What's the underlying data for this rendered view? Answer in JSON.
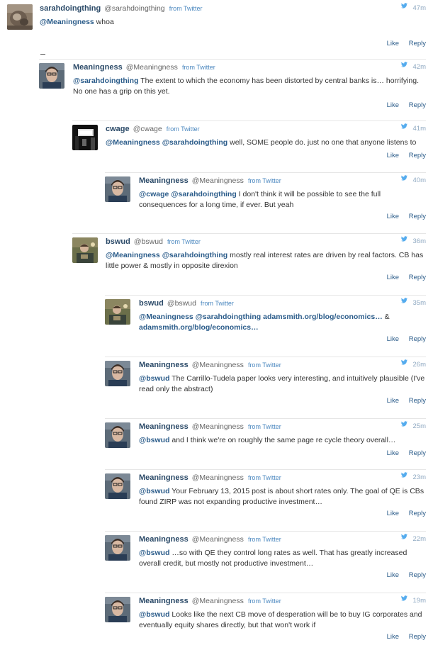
{
  "brand_colors": {
    "name": "#2b4a68",
    "link": "#2b5c8a",
    "source": "#4a87bf",
    "time": "#8fa9c2",
    "divider": "#e6e6e6"
  },
  "tweets": [
    {
      "name": "sarahdoingthing",
      "handle": "@sarahdoingthing",
      "source": "from Twitter",
      "time": "47m",
      "avatar": "sarah-avatar",
      "segments": [
        {
          "t": "@Meaningness",
          "m": true
        },
        {
          "t": " whoa"
        }
      ],
      "like": "Like",
      "reply": "Reply"
    },
    {
      "name": "Meaningness",
      "handle": "@Meaningness",
      "source": "from Twitter",
      "time": "42m",
      "avatar": "meaningness-avatar",
      "segments": [
        {
          "t": "@sarahdoingthing",
          "m": true
        },
        {
          "t": " The extent to which the economy has been distorted by central banks is… horrifying. No one has a grip on this yet."
        }
      ],
      "like": "Like",
      "reply": "Reply"
    },
    {
      "name": "cwage",
      "handle": "@cwage",
      "source": "from Twitter",
      "time": "41m",
      "avatar": "cwage-avatar",
      "segments": [
        {
          "t": "@Meaningness",
          "m": true
        },
        {
          "t": " "
        },
        {
          "t": "@sarahdoingthing",
          "m": true
        },
        {
          "t": " well, SOME people do. just no one that anyone listens to"
        }
      ],
      "like": "Like",
      "reply": "Reply"
    },
    {
      "name": "Meaningness",
      "handle": "@Meaningness",
      "source": "from Twitter",
      "time": "40m",
      "avatar": "meaningness-avatar",
      "segments": [
        {
          "t": "@cwage",
          "m": true
        },
        {
          "t": " "
        },
        {
          "t": "@sarahdoingthing",
          "m": true
        },
        {
          "t": " I don't think it will be possible to see the full consequences for a long time, if ever. But yeah"
        }
      ],
      "like": "Like",
      "reply": "Reply"
    },
    {
      "name": "bswud",
      "handle": "@bswud",
      "source": "from Twitter",
      "time": "36m",
      "avatar": "bswud-avatar",
      "segments": [
        {
          "t": "@Meaningness",
          "m": true
        },
        {
          "t": " "
        },
        {
          "t": "@sarahdoingthing",
          "m": true
        },
        {
          "t": " mostly real interest rates are driven by real factors. CB has little power & mostly in opposite direxion"
        }
      ],
      "like": "Like",
      "reply": "Reply"
    },
    {
      "name": "bswud",
      "handle": "@bswud",
      "source": "from Twitter",
      "time": "35m",
      "avatar": "bswud-avatar",
      "segments": [
        {
          "t": "@Meaningness",
          "m": true
        },
        {
          "t": " "
        },
        {
          "t": "@sarahdoingthing",
          "m": true
        },
        {
          "t": " "
        },
        {
          "t": "adamsmith.org/blog/economics…",
          "m": true
        },
        {
          "t": " & "
        },
        {
          "t": "adamsmith.org/blog/economics…",
          "m": true
        }
      ],
      "like": "Like",
      "reply": "Reply"
    },
    {
      "name": "Meaningness",
      "handle": "@Meaningness",
      "source": "from Twitter",
      "time": "26m",
      "avatar": "meaningness-avatar",
      "segments": [
        {
          "t": "@bswud",
          "m": true
        },
        {
          "t": " The Carrillo-Tudela paper looks very interesting, and intuitively plausible (I've read only the abstract)"
        }
      ],
      "like": "Like",
      "reply": "Reply"
    },
    {
      "name": "Meaningness",
      "handle": "@Meaningness",
      "source": "from Twitter",
      "time": "25m",
      "avatar": "meaningness-avatar",
      "segments": [
        {
          "t": "@bswud",
          "m": true
        },
        {
          "t": " and I think we're on roughly the same page re cycle theory overall…"
        }
      ],
      "like": "Like",
      "reply": "Reply"
    },
    {
      "name": "Meaningness",
      "handle": "@Meaningness",
      "source": "from Twitter",
      "time": "23m",
      "avatar": "meaningness-avatar",
      "segments": [
        {
          "t": "@bswud",
          "m": true
        },
        {
          "t": " Your February 13, 2015 post is about short rates only. The goal of QE is CBs found ZIRP was not expanding productive investment…"
        }
      ],
      "like": "Like",
      "reply": "Reply"
    },
    {
      "name": "Meaningness",
      "handle": "@Meaningness",
      "source": "from Twitter",
      "time": "22m",
      "avatar": "meaningness-avatar",
      "segments": [
        {
          "t": "@bswud",
          "m": true
        },
        {
          "t": " …so with QE they control long rates as well. That has greatly increased overall credit, but mostly not productive investment…"
        }
      ],
      "like": "Like",
      "reply": "Reply"
    },
    {
      "name": "Meaningness",
      "handle": "@Meaningness",
      "source": "from Twitter",
      "time": "19m",
      "avatar": "meaningness-avatar",
      "segments": [
        {
          "t": "@bswud",
          "m": true
        },
        {
          "t": " Looks like the next CB move of desperation will be to buy IG corporates and eventually equity shares directly, but that won't work if"
        }
      ],
      "like": "Like",
      "reply": "Reply"
    }
  ]
}
